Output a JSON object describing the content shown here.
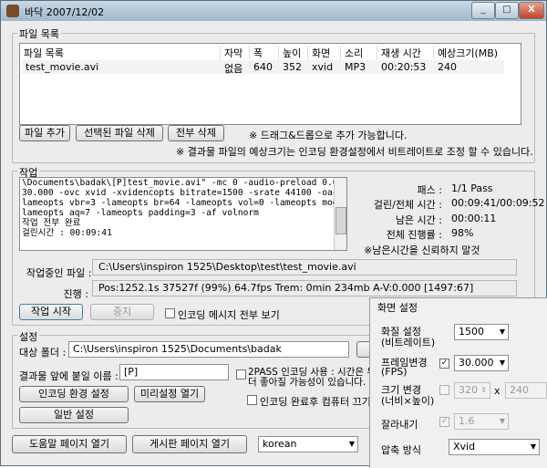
{
  "window": {
    "title": "바닥 2007/12/02",
    "minimize": "_",
    "maximize": "□",
    "close": "X"
  },
  "file_group": {
    "label": "파일 목록",
    "columns": [
      "파일 목록",
      "자막",
      "폭",
      "높이",
      "화면",
      "소리",
      "재생 시간",
      "예상크기(MB)"
    ],
    "rows": [
      [
        "test_movie.avi",
        "없음",
        "640",
        "352",
        "xvid",
        "MP3",
        "00:20:53",
        "240"
      ]
    ],
    "add_button": "파일 추가",
    "delete_selected_button": "선택된 파일 삭제",
    "delete_all_button": "전부 삭제",
    "drag_note": "※ 드래그&드롭으로 추가 가능합니다.",
    "size_note": "※ 결과물 파일의 예상크기는 인코딩 환경설정에서 비트레이트로 조정 할 수 있습니다."
  },
  "job_group": {
    "label": "작업",
    "log_lines": [
      "\\Documents\\badak\\[P]test_movie.avi\" -mc 0 -audio-preload 0.0 -ofps",
      "30.000 -ovc xvid -xvidencopts bitrate=1500 -srate 44100 -oac mp3lame -",
      "lameopts vbr=3 -lameopts br=64 -lameopts vol=0 -lameopts mode=1 -",
      "lameopts aq=7 -lameopts padding=3 -af volnorm",
      "작업 전부 완료",
      "걸린시간 : 00:09:41"
    ],
    "stats": [
      {
        "label": "패스 :",
        "value": "1/1 Pass"
      },
      {
        "label": "걸린/전체 시간 :",
        "value": "00:09:41/00:09:52"
      },
      {
        "label": "남은 시간 :",
        "value": "00:00:11"
      },
      {
        "label": "전체 진행률 :",
        "value": "98%"
      }
    ],
    "remaining_note": "※남은시간을 신뢰하지 말것",
    "current_file_label": "작업중인 파일 :",
    "current_file_value": "C:\\Users\\inspiron 1525\\Desktop\\test\\test_movie.avi",
    "progress_label": "진행 :",
    "progress_value": "Pos:1252.1s  37527f (99%) 64.7fps Trem:    0min 234mb  A-V:0.000 [1497:67]",
    "start_button": "작업 시작",
    "stop_button": "중지",
    "show_all_messages": "인코딩 메시지 전부 보기"
  },
  "settings_group": {
    "label": "설정",
    "target_folder_label": "대상 폴더 :",
    "target_folder_value": "C:\\Users\\inspiron 1525\\Documents\\badak",
    "prefix_label": "결과물 앞에 붙일 이름 :",
    "prefix_value": "[P]",
    "twopass_line1": "2PASS 인코딩 사용 : 시간은 두",
    "twopass_line2": "더 좋아질 가능성이 있습니다.",
    "encoding_env_button": "인코딩 환경 설정",
    "preset_open_button": "미리설정 열기",
    "shutdown_after": "인코딩 완료후 컴퓨터 끄기",
    "general_settings_button": "일반 설정"
  },
  "bottom": {
    "help_button": "도움말 페이지 열기",
    "forum_button": "게시판 페이지 열기",
    "language_value": "korean"
  },
  "video_panel": {
    "label": "화면 설정",
    "quality_label1": "화질 설정",
    "quality_label2": "(비트레이트)",
    "quality_value": "1500",
    "frame_label1": "프레임변경",
    "frame_label2": "(FPS)",
    "frame_value": "30.000",
    "size_label1": "크기 변경",
    "size_label2": "(너비×높이)",
    "width_value": "320",
    "x_sign": "x",
    "height_value": "240",
    "crop_label": "잘라내기",
    "crop_value": "1.6",
    "codec_label": "압축 방식",
    "codec_value": "Xvid"
  }
}
